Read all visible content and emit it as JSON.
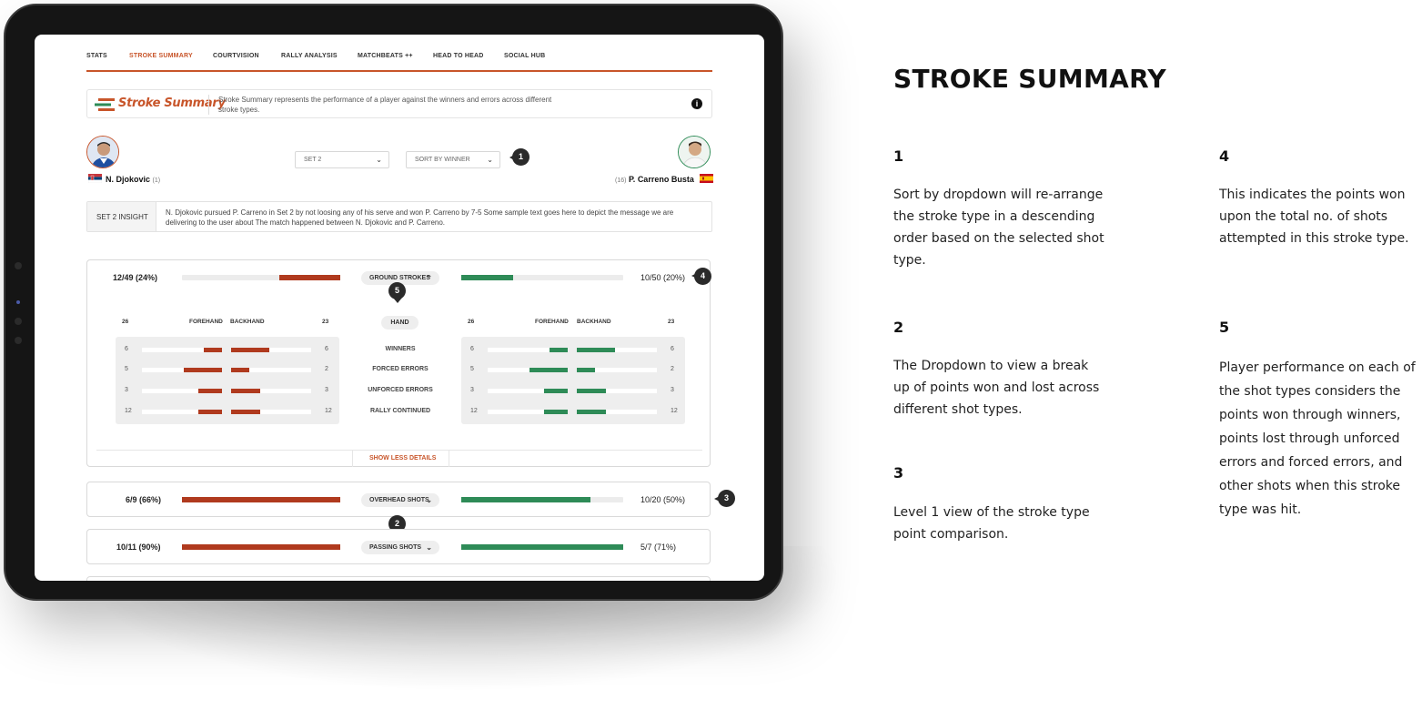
{
  "nav": {
    "items": [
      "STATS",
      "STROKE SUMMARY",
      "COURTVISION",
      "RALLY ANALYSIS",
      "MATCHBEATS ++",
      "HEAD TO HEAD",
      "SOCIAL HUB"
    ],
    "active": "STROKE SUMMARY"
  },
  "header": {
    "logo_text": "Stroke Summary",
    "description": "Stroke Summary represents the performance of a player against the winners and errors across different stroke types.",
    "info_icon": "i"
  },
  "players": {
    "left": {
      "name": "N. Djokovic",
      "seed": "(1)"
    },
    "right": {
      "name": "P. Carreno Busta",
      "seed": "(16)"
    }
  },
  "filters": {
    "set": "SET 2",
    "sort": "SORT BY WINNER"
  },
  "insight": {
    "label": "SET 2 INSIGHT",
    "text": "N. Djokovic pursued P. Carreno in Set 2 by  not loosing any of his serve and won P. Carreno by 7-5 Some sample text goes here to depict the message we are delivering to the user about  The match happened between N. Djokovic and P. Carreno."
  },
  "callouts": [
    "1",
    "2",
    "3",
    "4",
    "5"
  ],
  "colors": {
    "accent": "#c8552a",
    "red_bar": "#b03a1e",
    "green_bar": "#2e8b57"
  },
  "strokes": [
    {
      "name": "GROUND STROKES",
      "left_score": "12/49 (24%)",
      "right_score": "10/50 (20%)",
      "left_fraction": 0.24,
      "right_fraction": 0.2,
      "expanded": true
    },
    {
      "name": "OVERHEAD SHOTS",
      "left_score": "6/9 (66%)",
      "right_score": "10/20 (50%)",
      "left_fraction": 0.66,
      "right_fraction": 0.5,
      "expanded": false
    },
    {
      "name": "PASSING SHOTS",
      "left_score": "10/11 (90%)",
      "right_score": "5/7 (71%)",
      "left_fraction": 0.9,
      "right_fraction": 0.71,
      "expanded": false
    }
  ],
  "breakdown": {
    "hand_label": "HAND",
    "left": {
      "total_forehand": "26",
      "forehand_label": "FOREHAND",
      "backhand_label": "BACKHAND",
      "total_backhand": "23"
    },
    "right": {
      "total_forehand": "26",
      "forehand_label": "FOREHAND",
      "backhand_label": "BACKHAND",
      "total_backhand": "23"
    },
    "rows": [
      {
        "label": "WINNERS",
        "left_fh": "6",
        "left_bh": "6",
        "right_fh": "6",
        "right_bh": "6"
      },
      {
        "label": "FORCED ERRORS",
        "left_fh": "5",
        "left_bh": "2",
        "right_fh": "5",
        "right_bh": "2"
      },
      {
        "label": "UNFORCED ERRORS",
        "left_fh": "3",
        "left_bh": "3",
        "right_fh": "3",
        "right_bh": "3"
      },
      {
        "label": "RALLY CONTINUED",
        "left_fh": "12",
        "left_bh": "12",
        "right_fh": "12",
        "right_bh": "12"
      }
    ],
    "show_less": "SHOW LESS DETAILS"
  },
  "side": {
    "title": "STROKE SUMMARY",
    "notes": [
      {
        "num": "1",
        "text": "Sort by dropdown will re-arrange the stroke type in a descending order based on the selected shot type."
      },
      {
        "num": "2",
        "text": "The Dropdown to view a break up of points won and lost across different shot types."
      },
      {
        "num": "3",
        "text": "Level 1 view of the stroke type point comparison."
      },
      {
        "num": "4",
        "text": "This indicates the points won upon the total no. of shots attempted in this stroke type."
      },
      {
        "num": "5",
        "text": "Player performance on each of the shot types considers the points won through winners, points lost through unforced errors and forced errors, and other shots when this stroke type was hit."
      }
    ]
  }
}
